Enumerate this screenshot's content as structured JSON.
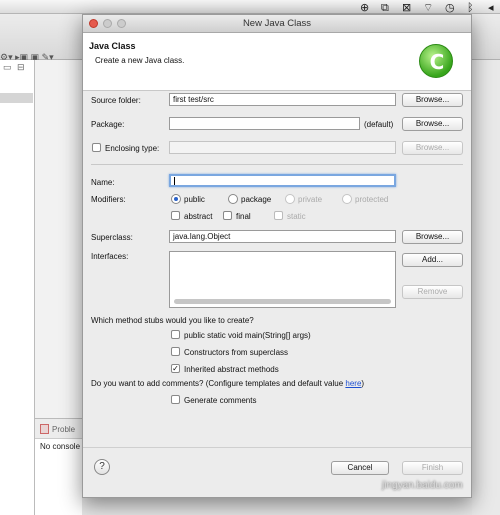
{
  "dialog": {
    "window_title": "New Java Class",
    "header_title": "Java Class",
    "header_subtitle": "Create a new Java class.",
    "logo_letter": "C"
  },
  "form": {
    "source_folder_label": "Source folder:",
    "source_folder_value": "first test/src",
    "package_label": "Package:",
    "package_value": "",
    "package_default": "(default)",
    "enclosing_type_label": "Enclosing type:",
    "name_label": "Name:",
    "name_value": "",
    "modifiers_label": "Modifiers:",
    "mod_public": "public",
    "mod_package": "package",
    "mod_private": "private",
    "mod_protected": "protected",
    "mod_abstract": "abstract",
    "mod_final": "final",
    "mod_static": "static",
    "superclass_label": "Superclass:",
    "superclass_value": "java.lang.Object",
    "interfaces_label": "Interfaces:",
    "stubs_question": "Which method stubs would you like to create?",
    "stub_main": "public static void main(String[] args)",
    "stub_constructors": "Constructors from superclass",
    "stub_inherited": "Inherited abstract methods",
    "comments_question": "Do you want to add comments? (Configure templates and default value",
    "comments_link": "here",
    "comments_close": ")",
    "generate_comments": "Generate comments"
  },
  "buttons": {
    "browse": "Browse...",
    "add": "Add...",
    "remove": "Remove",
    "cancel": "Cancel",
    "finish": "Finish",
    "help": "?"
  },
  "background": {
    "problems_tab": "Proble",
    "console_text": "No console"
  },
  "watermark": "jingyan.baidu.com",
  "colors": {
    "close_button": "#e55b4e",
    "focus_ring": "#7aa7e0",
    "link": "#1d4fd1",
    "logo_green": "#37a51b"
  }
}
